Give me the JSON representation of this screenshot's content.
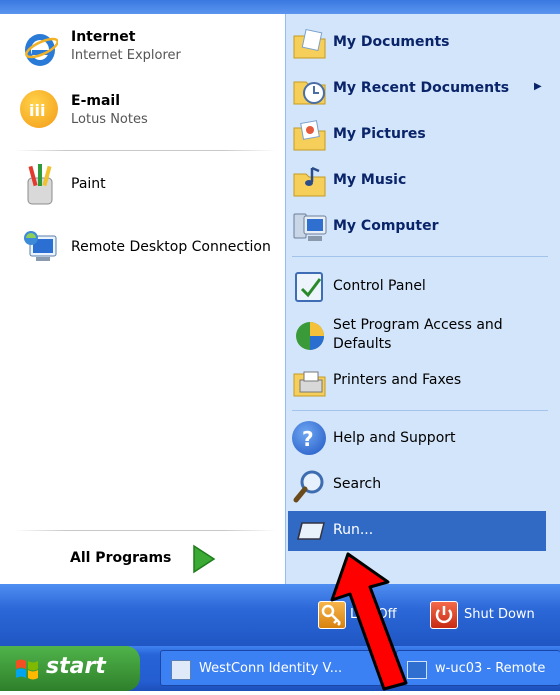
{
  "start_menu": {
    "pinned": [
      {
        "title": "Internet",
        "subtitle": "Internet Explorer",
        "icon": "internet-explorer-icon"
      },
      {
        "title": "E-mail",
        "subtitle": "Lotus Notes",
        "icon": "lotus-notes-icon"
      }
    ],
    "recent_programs": [
      {
        "label": "Paint",
        "icon": "paint-icon"
      },
      {
        "label": "Remote Desktop Connection",
        "icon": "remote-desktop-icon"
      }
    ],
    "all_programs_label": "All Programs",
    "places": [
      {
        "label": "My Documents",
        "icon": "my-documents-icon"
      },
      {
        "label": "My Recent Documents",
        "icon": "my-recent-documents-icon",
        "submenu_arrow": "▶"
      },
      {
        "label": "My Pictures",
        "icon": "my-pictures-icon"
      },
      {
        "label": "My Music",
        "icon": "my-music-icon"
      },
      {
        "label": "My Computer",
        "icon": "my-computer-icon"
      }
    ],
    "settings": [
      {
        "label": "Control Panel",
        "icon": "control-panel-icon"
      },
      {
        "label": "Set Program Access and Defaults",
        "icon": "program-access-icon"
      },
      {
        "label": "Printers and Faxes",
        "icon": "printers-faxes-icon"
      }
    ],
    "help": [
      {
        "label": "Help and Support",
        "icon": "help-icon"
      },
      {
        "label": "Search",
        "icon": "search-icon"
      },
      {
        "label": "Run...",
        "icon": "run-icon"
      }
    ],
    "log_off_label": "Log Off",
    "shut_down_label": "Shut Down"
  },
  "taskbar": {
    "start_label": "start",
    "buttons": [
      {
        "label": "WestConn Identity V...",
        "icon": "ie-window-icon"
      },
      {
        "label": "w-uc03 - Remote",
        "icon": "remote-desktop-window-icon"
      }
    ]
  },
  "colors": {
    "highlight": "#316ac5",
    "right_pane": "#d3e5fa",
    "start_button": "#3f9a3a",
    "annotation_arrow": "#ff0000"
  }
}
